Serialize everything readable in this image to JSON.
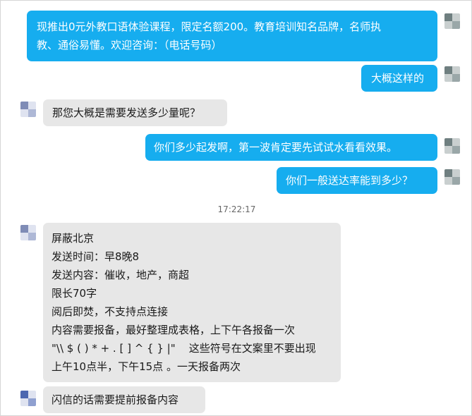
{
  "chat": {
    "timestamp": "17:22:17",
    "messages": [
      {
        "side": "outgoing",
        "lines": [
          "现推出0元外教口语体验课程，限定名额200。教育培训知名品牌，名师执",
          "教、通俗易懂。欢迎咨询：（电话号码）"
        ]
      },
      {
        "side": "outgoing",
        "lines": [
          "大概这样的"
        ]
      },
      {
        "side": "incoming",
        "lines": [
          "那您大概是需要发送多少量呢？"
        ]
      },
      {
        "side": "outgoing",
        "lines": [
          "你们多少起发啊，第一波肯定要先试试水看看效果。"
        ]
      },
      {
        "side": "outgoing",
        "lines": [
          "你们一般送达率能到多少？"
        ]
      },
      {
        "side": "incoming",
        "lines": [
          "屏蔽北京",
          "发送时间：早8晚8",
          "发送内容：催收，地产，商超",
          "限长70字",
          "阅后即焚，不支持点连接",
          "内容需要报备，最好整理成表格，上下午各报备一次",
          "\"\\\\ $ ( ) * + . [ ] ^ { } |\"    这些符号在文案里不要出现",
          "上午10点半，下午15点 。一天报备两次"
        ]
      },
      {
        "side": "incoming",
        "lines": [
          "闪信的话需要提前报备内容"
        ]
      }
    ]
  },
  "colors": {
    "outgoing_bubble": "#16adef",
    "incoming_bubble": "#e7e7e7",
    "page_background": "#ffffff"
  }
}
